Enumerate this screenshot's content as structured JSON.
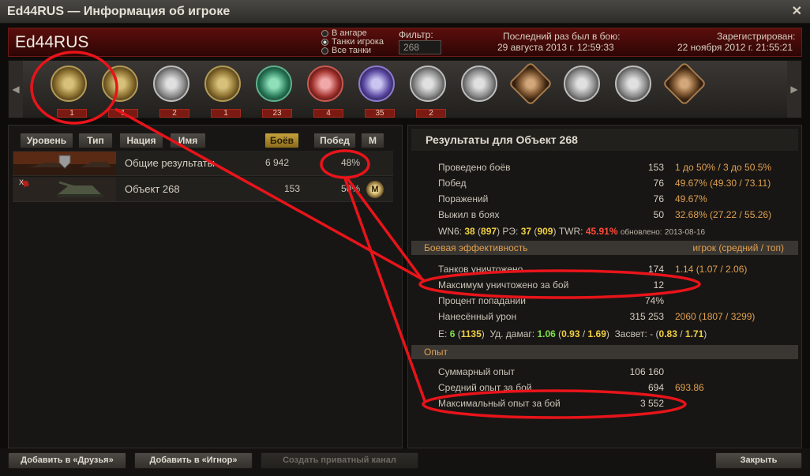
{
  "window": {
    "title": "Ed44RUS — Информация об игроке",
    "close_label": "✕"
  },
  "header": {
    "player_name": "Ed44RUS",
    "radio_options": [
      {
        "label": "В ангаре",
        "selected": false
      },
      {
        "label": "Танки игрока",
        "selected": true
      },
      {
        "label": "Все танки",
        "selected": false
      }
    ],
    "filter_label": "Фильтр:",
    "filter_value": "268",
    "last_battle_label": "Последний раз был в бою:",
    "last_battle_value": "29 августа 2013 г. 12:59:33",
    "registered_label": "Зарегистрирован:",
    "registered_value": "22 ноября 2012 г. 21:55:21"
  },
  "medals": [
    {
      "name": "medal-tank-hero",
      "count": "1",
      "style": "gold"
    },
    {
      "name": "medal-sun",
      "count": "1",
      "style": "gold"
    },
    {
      "name": "medal-sniper",
      "count": "2",
      "style": "silver"
    },
    {
      "name": "medal-wot-shield",
      "count": "1",
      "style": "gold"
    },
    {
      "name": "medal-green-shell",
      "count": "23",
      "style": "green"
    },
    {
      "name": "medal-red-shell",
      "count": "4",
      "style": "red"
    },
    {
      "name": "medal-purple-shell",
      "count": "35",
      "style": "purple"
    },
    {
      "name": "medal-tank-wreath",
      "count": "2",
      "style": "silver"
    },
    {
      "name": "medal-portrait-1",
      "count": "",
      "style": "silver"
    },
    {
      "name": "medal-cross-1",
      "count": "",
      "style": "bronze"
    },
    {
      "name": "medal-star-1",
      "count": "",
      "style": "silver"
    },
    {
      "name": "medal-star-2",
      "count": "",
      "style": "silver"
    },
    {
      "name": "medal-cross-2",
      "count": "",
      "style": "bronze"
    }
  ],
  "table": {
    "columns": {
      "level": "Уровень",
      "type": "Тип",
      "nation": "Нация",
      "name": "Имя",
      "battles": "Боёв",
      "wins": "Побед",
      "mastery": "М"
    },
    "rows": [
      {
        "name": "Общие результаты",
        "battles": "6 942",
        "wins": "48%",
        "mastery": ""
      },
      {
        "name": "Объект 268",
        "battles": "153",
        "wins": "50%",
        "mastery": "M",
        "tier": "X"
      }
    ]
  },
  "results": {
    "title": "Результаты для Объект 268",
    "general": [
      {
        "label": "Проведено боёв",
        "value": "153",
        "avg": "1 до 50% / 3 до 50.5%"
      },
      {
        "label": "Побед",
        "value": "76",
        "avg": "49.67% (49.30 / 73.11)"
      },
      {
        "label": "Поражений",
        "value": "76",
        "avg": "49.67%"
      },
      {
        "label": "Выжил в боях",
        "value": "50",
        "avg": "32.68% (27.22 / 55.26)"
      }
    ],
    "rating_line": {
      "wn6_label": "WN6:",
      "wn6": "38",
      "wn6_pos": "897",
      "re_label": "РЭ:",
      "re": "37",
      "re_pos": "909",
      "twr_label": "TWR:",
      "twr": "45.91%",
      "updated_label": "обновлено:",
      "updated": "2013-08-16"
    },
    "battle_header": "Боевая эффективность",
    "battle_header_right": "игрок (средний / топ)",
    "battle": [
      {
        "label": "Танков уничтожено",
        "value": "174",
        "avg": "1.14 (1.07 / 2.06)"
      },
      {
        "label": "Максимум уничтожено за бой",
        "value": "12",
        "avg": ""
      },
      {
        "label": "Процент попадании",
        "value": "74%",
        "avg": ""
      },
      {
        "label": "Нанесённый урон",
        "value": "315 253",
        "avg": "2060 (1807 / 3299)"
      }
    ],
    "efficiency_line": {
      "e_label": "E:",
      "e": "6",
      "e_pos": "1135",
      "dmg_label": "Уд. дамаг:",
      "dmg": "1.06",
      "dmg_avg": "0.93",
      "dmg_top": "1.69",
      "spot_label": "Засвет:",
      "spot": "-",
      "spot_avg": "0.83",
      "spot_top": "1.71"
    },
    "exp_header": "Опыт",
    "exp": [
      {
        "label": "Суммарный опыт",
        "value": "106 160",
        "avg": ""
      },
      {
        "label": "Средний опыт за бой",
        "value": "694",
        "avg": "693.86"
      },
      {
        "label": "Максимальный опыт за бой",
        "value": "3 552",
        "avg": ""
      }
    ]
  },
  "footer": {
    "add_friend": "Добавить в «Друзья»",
    "add_ignore": "Добавить в «Игнор»",
    "private_channel": "Создать приватный канал",
    "close": "Закрыть"
  },
  "colors": {
    "accent": "#e0a050",
    "header_red": "#5a0e0c",
    "annotation": "#e8141a"
  }
}
